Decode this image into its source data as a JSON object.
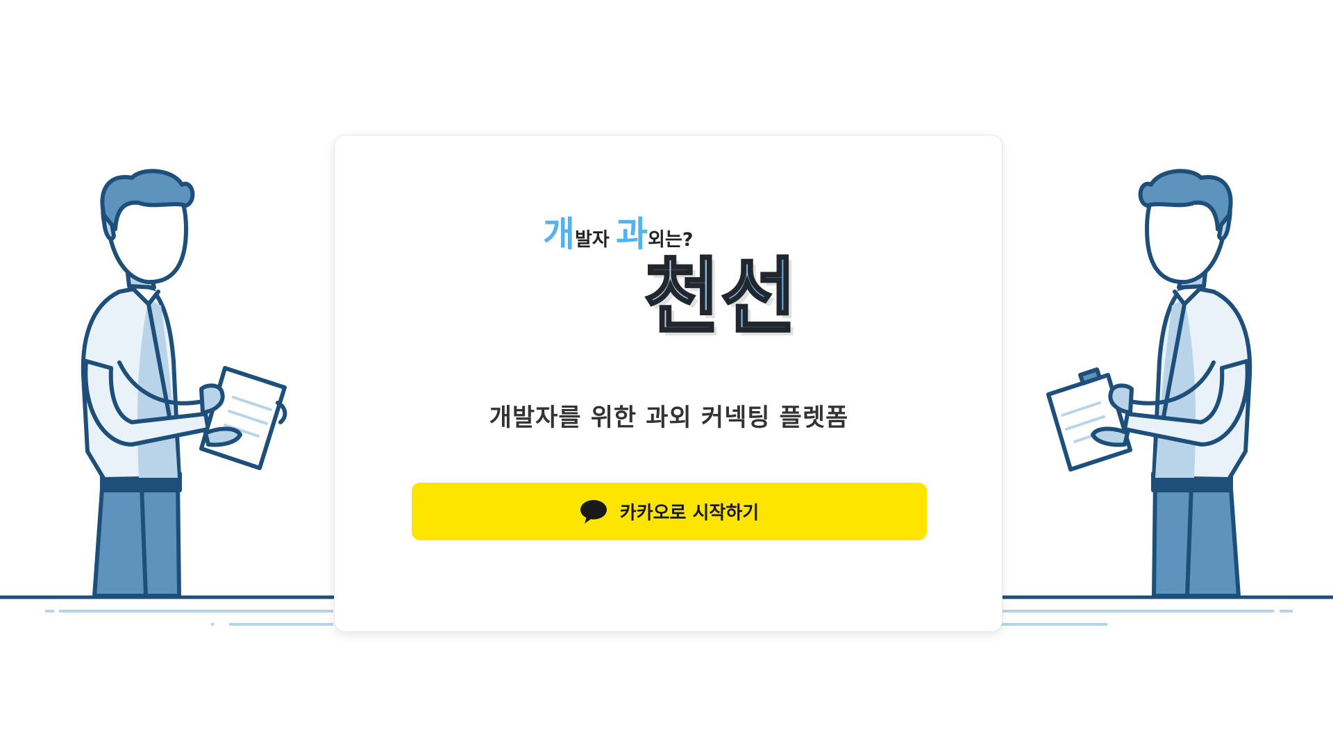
{
  "tagline": {
    "char1": "개",
    "text1": "발자 ",
    "char2": "과",
    "text2": "외는?"
  },
  "brand": "천선",
  "subtitle": "개발자를 위한 과외 커넥팅 플렛폼",
  "login_button": {
    "label": "카카오로 시작하기",
    "icon": "speech-bubble-icon"
  },
  "colors": {
    "accent": "#55b2ef",
    "kakao_yellow": "#fee500",
    "illustration_dark": "#1d4f7a",
    "illustration_mid": "#5e93bd",
    "illustration_light": "#b9d3e8"
  }
}
